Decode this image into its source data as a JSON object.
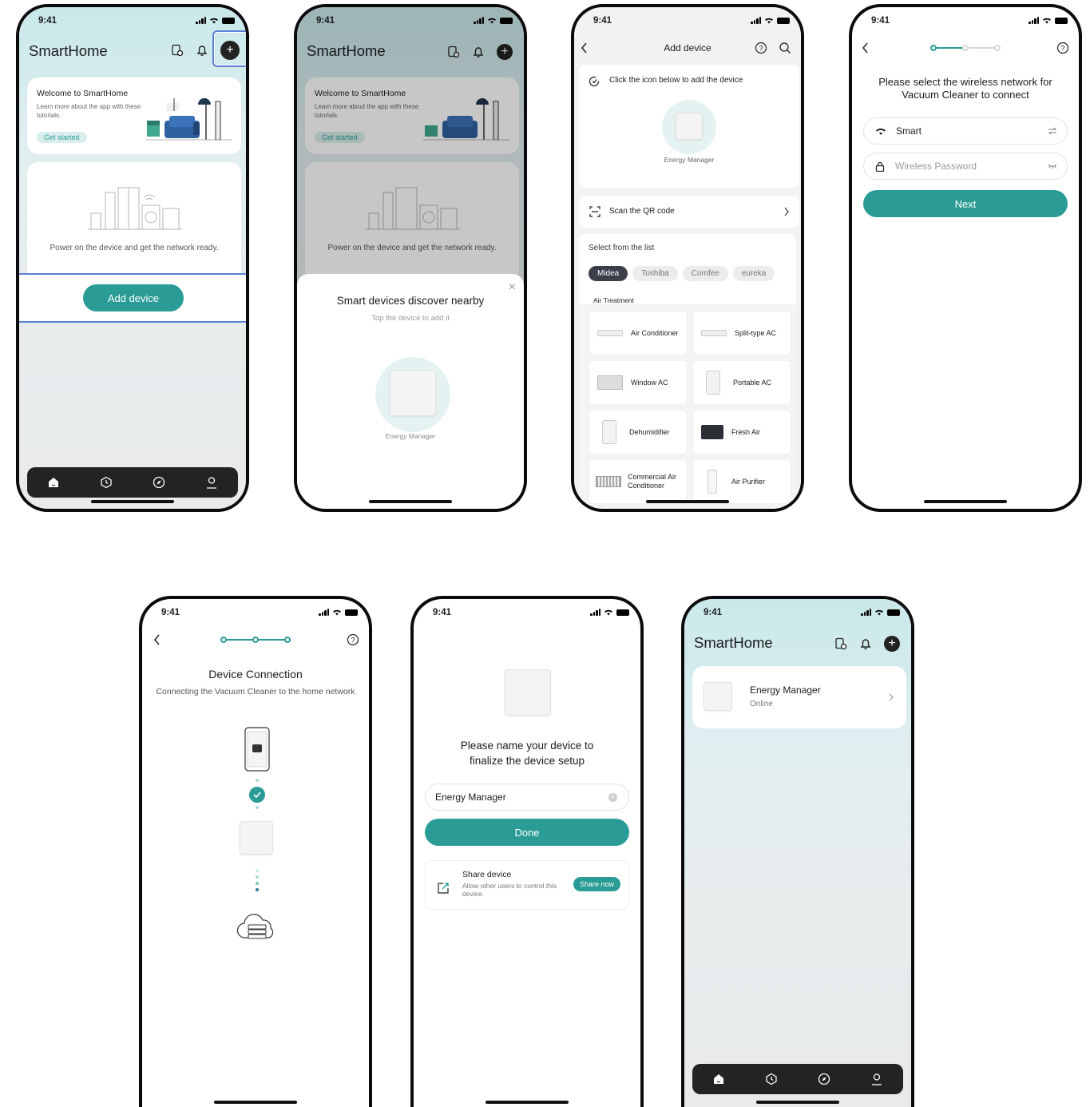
{
  "status_time": "9:41",
  "home": {
    "title": "SmartHome",
    "welcome_title": "Welcome to SmartHome",
    "welcome_desc": "Learn more about the app with these tutorials.",
    "get_started": "Get started",
    "power_on_text": "Power on the device and get the network ready.",
    "add_device": "Add device"
  },
  "discover": {
    "title": "Smart devices discover nearby",
    "subtitle": "Top the device to add it",
    "device_name": "Energy Manager"
  },
  "add_device": {
    "title": "Add device",
    "click_hint": "Click the icon below to add the device",
    "device_name": "Energy Manager",
    "scan_qr": "Scan the QR code",
    "select_list": "Select from the list",
    "brands": [
      "Midea",
      "Toshiba",
      "Comfee",
      "eureka"
    ],
    "category": "Air Treatment",
    "items": [
      "Air Conditioner",
      "Split-type AC",
      "Window AC",
      "Portable AC",
      "Dehumidifier",
      "Fresh Air",
      "Commercial Air Conditioner",
      "Air Purifier"
    ]
  },
  "wifi": {
    "heading": "Please select the wireless network for Vacuum Cleaner to connect",
    "network": "Smart",
    "password_placeholder": "Wireless Password",
    "next": "Next"
  },
  "connection": {
    "title": "Device Connection",
    "subtitle": "Connecting the Vacuum Cleaner to the home network"
  },
  "name_device": {
    "heading": "Please name your device to finalize the device setup",
    "name_value": "Energy Manager",
    "done": "Done",
    "share_title": "Share device",
    "share_desc": "Allow other users to control this device.",
    "share_now": "Share now"
  },
  "home_after": {
    "title": "SmartHome",
    "device_name": "Energy Manager",
    "device_status": "Online"
  },
  "colors": {
    "accent": "#2a9c95",
    "highlight": "#5c7fd6",
    "tabbar": "#222325"
  }
}
